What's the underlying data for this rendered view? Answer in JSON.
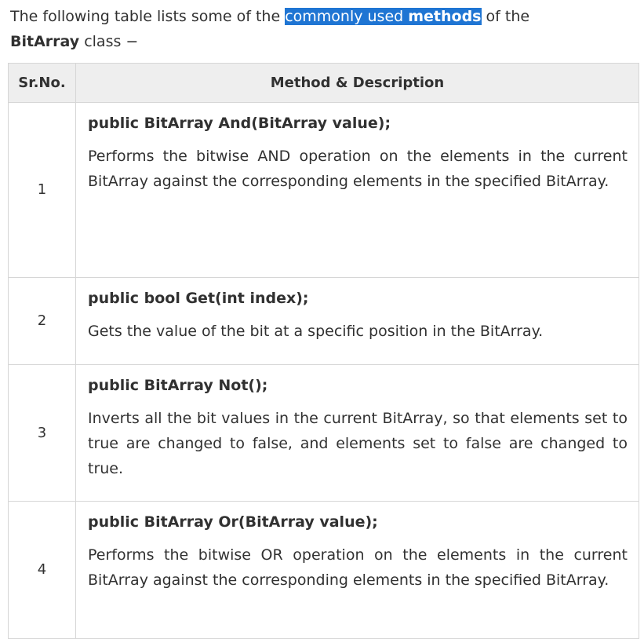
{
  "intro": {
    "before": "The following table lists some of the ",
    "highlight_plain": "commonly used ",
    "highlight_bold": "methods",
    "after": " of the ",
    "class_name": "BitArray",
    "end": " class −"
  },
  "table": {
    "headers": {
      "num": "Sr.No.",
      "desc": "Method & Description"
    },
    "rows": [
      {
        "num": "1",
        "signature": "public BitArray And(BitArray value);",
        "description": "Performs the bitwise AND operation on the elements in the current BitArray against the corresponding elements in the specified BitArray."
      },
      {
        "num": "2",
        "signature": "public bool Get(int index);",
        "description": "Gets the value of the bit at a specific position in the BitArray."
      },
      {
        "num": "3",
        "signature": "public BitArray Not();",
        "description": "Inverts all the bit values in the current BitArray, so that elements set to true are changed to false, and elements set to false are changed to true."
      },
      {
        "num": "4",
        "signature": "public BitArray Or(BitArray value);",
        "description": "Performs the bitwise OR operation on the elements in the current BitArray against the corresponding elements in the specified BitArray."
      }
    ]
  },
  "colors": {
    "text": "#313131",
    "selection": "#1f75d3",
    "header_bg": "#eeeeee",
    "border": "#d6d6d6"
  }
}
